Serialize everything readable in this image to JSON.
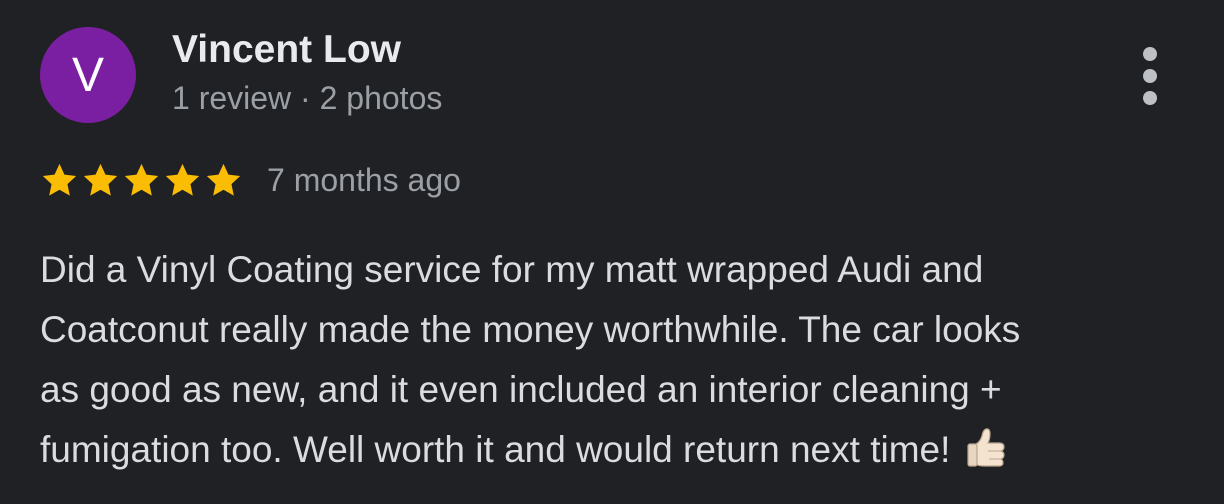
{
  "reviewer": {
    "avatar_letter": "V",
    "avatar_color": "#7b1fa2",
    "name": "Vincent Low",
    "meta": "1 review · 2 photos"
  },
  "menu": {
    "icon": "more-vert-icon"
  },
  "review": {
    "rating": 5,
    "rating_max": 5,
    "star_color": "#fbbc04",
    "date": "7 months ago",
    "text_lines": [
      "Did a Vinyl Coating service for my matt wrapped Audi and",
      "Coatconut really made the money worthwhile. The car looks",
      "as good as new, and it even included an interior cleaning +",
      "fumigation too. Well worth it and would return next time!"
    ],
    "emoji": "thumbs-up-icon"
  }
}
